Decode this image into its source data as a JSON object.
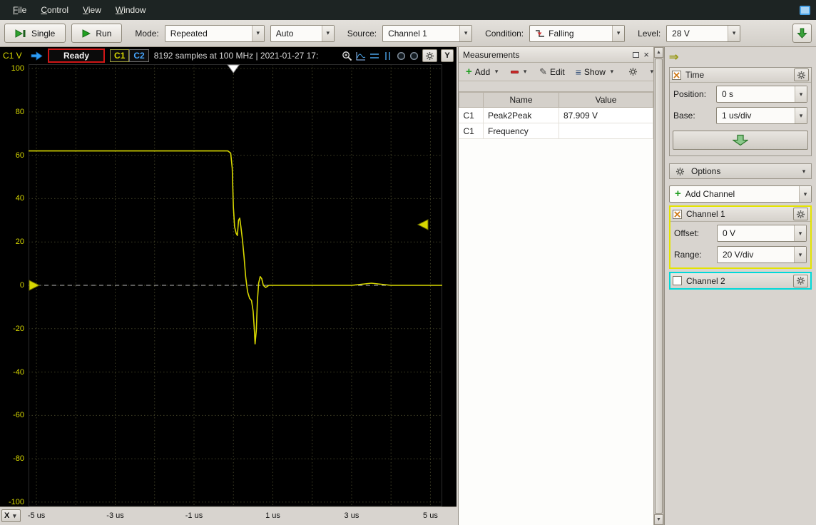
{
  "menubar": {
    "items": [
      "File",
      "Control",
      "View",
      "Window"
    ]
  },
  "toolbar": {
    "single": "Single",
    "run": "Run",
    "mode_label": "Mode:",
    "mode_value": "Repeated",
    "trigger_mode_value": "Auto",
    "source_label": "Source:",
    "source_value": "Channel 1",
    "condition_label": "Condition:",
    "condition_value": "Falling",
    "level_label": "Level:",
    "level_value": "28 V"
  },
  "scope": {
    "channel_unit_label": "C1 V",
    "status": "Ready",
    "tabs": [
      "C1",
      "C2"
    ],
    "info": "8192 samples at 100 MHz | 2021-01-27 17:",
    "y_button": "Y",
    "x_button": "X"
  },
  "measurements": {
    "title": "Measurements",
    "add": "Add",
    "edit": "Edit",
    "show": "Show",
    "columns": [
      "",
      "Name",
      "Value"
    ],
    "rows": [
      {
        "channel": "C1",
        "name": "Peak2Peak",
        "value": "87.909 V"
      },
      {
        "channel": "C1",
        "name": "Frequency",
        "value": ""
      }
    ]
  },
  "rightpanel": {
    "time": {
      "title": "Time",
      "position_label": "Position:",
      "position_value": "0 s",
      "base_label": "Base:",
      "base_value": "1 us/div"
    },
    "options": "Options",
    "add_channel": "Add Channel",
    "channel1": {
      "title": "Channel 1",
      "enabled": true,
      "offset_label": "Offset:",
      "offset_value": "0 V",
      "range_label": "Range:",
      "range_value": "20 V/div"
    },
    "channel2": {
      "title": "Channel 2",
      "enabled": false
    }
  },
  "chart_data": {
    "type": "line",
    "title": "Oscilloscope trace",
    "xlabel": "Time",
    "ylabel": "C1 V",
    "x_unit": "us",
    "y_unit": "V",
    "xlim": [
      -5.2,
      5.3
    ],
    "ylim": [
      -102,
      102
    ],
    "x_grid_step": 1,
    "y_grid_step": 20,
    "grid": "dotted",
    "x_ticks": [
      {
        "value": -5,
        "label": "-5 us"
      },
      {
        "value": -3,
        "label": "-3 us"
      },
      {
        "value": -1,
        "label": "-1 us"
      },
      {
        "value": 1,
        "label": "1 us"
      },
      {
        "value": 3,
        "label": "3 us"
      },
      {
        "value": 5,
        "label": "5 us"
      }
    ],
    "y_ticks": [
      100,
      80,
      60,
      40,
      20,
      0,
      -20,
      -40,
      -60,
      -80,
      -100
    ],
    "trigger": {
      "type": "falling",
      "source": "Channel 1",
      "level": 28,
      "position": 0
    },
    "channel_offset": 0,
    "time_base": "1 us/div",
    "range": "20 V/div",
    "series": [
      {
        "name": "Channel 1",
        "color": "#d8d800",
        "points": [
          [
            -5.2,
            62
          ],
          [
            -4.6,
            62
          ],
          [
            -4,
            62
          ],
          [
            -3.4,
            62
          ],
          [
            -2.8,
            62
          ],
          [
            -2.2,
            62
          ],
          [
            -1.6,
            62
          ],
          [
            -1,
            62
          ],
          [
            -0.55,
            62
          ],
          [
            -0.3,
            62
          ],
          [
            -0.14,
            62
          ],
          [
            -0.07,
            61
          ],
          [
            -0.03,
            54
          ],
          [
            0,
            36
          ],
          [
            0.03,
            27
          ],
          [
            0.07,
            24
          ],
          [
            0.1,
            23
          ],
          [
            0.13,
            30
          ],
          [
            0.16,
            31
          ],
          [
            0.19,
            27
          ],
          [
            0.23,
            21
          ],
          [
            0.27,
            13
          ],
          [
            0.31,
            4
          ],
          [
            0.36,
            -3
          ],
          [
            0.41,
            -6
          ],
          [
            0.46,
            -7
          ],
          [
            0.5,
            -12
          ],
          [
            0.53,
            -20
          ],
          [
            0.55,
            -27
          ],
          [
            0.58,
            -21
          ],
          [
            0.61,
            -7
          ],
          [
            0.64,
            1
          ],
          [
            0.68,
            4
          ],
          [
            0.72,
            3
          ],
          [
            0.76,
            0
          ],
          [
            0.82,
            -1
          ],
          [
            0.9,
            0
          ],
          [
            1.1,
            0
          ],
          [
            1.5,
            0
          ],
          [
            2,
            0
          ],
          [
            2.5,
            0
          ],
          [
            3,
            0
          ],
          [
            3.5,
            1
          ],
          [
            4,
            0
          ],
          [
            4.5,
            0
          ],
          [
            5,
            0
          ],
          [
            5.3,
            0
          ]
        ]
      }
    ]
  },
  "colors": {
    "channel1": "#d8d800",
    "channel2": "#00d9d9",
    "trigger_blue": "#2e9df5",
    "status_red": "#cf1616",
    "plot_bg": "#000000",
    "grid": "#3f3f26",
    "panel_bg": "#d8d4cf"
  }
}
